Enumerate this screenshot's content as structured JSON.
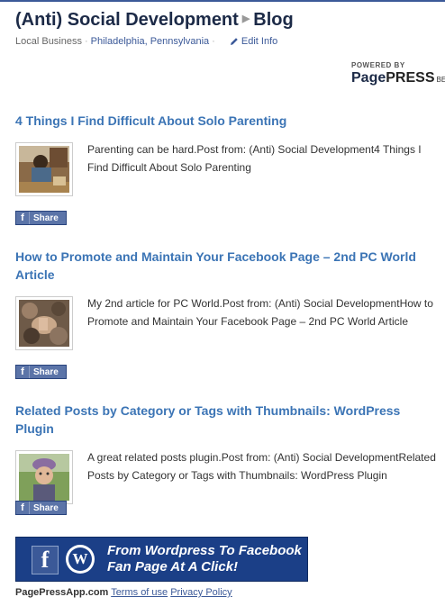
{
  "header": {
    "page_name": "(Anti) Social Development",
    "section": "Blog",
    "category": "Local Business",
    "location": "Philadelphia, Pennsylvania",
    "edit_label": "Edit Info"
  },
  "powered": {
    "small": "POWERED BY",
    "brand_a": "Page",
    "brand_b": "PRESS",
    "beta": "BETA"
  },
  "posts": [
    {
      "title": "4 Things I Find Difficult About Solo Parenting",
      "excerpt": "Parenting can be hard.Post from: (Anti) Social Development4 Things I Find Difficult About Solo Parenting",
      "share": "Share"
    },
    {
      "title": "How to Promote and Maintain Your Facebook Page – 2nd PC World Article",
      "excerpt": "My 2nd article for PC World.Post from: (Anti) Social DevelopmentHow to Promote and Maintain Your Facebook Page – 2nd PC World Article",
      "share": "Share"
    },
    {
      "title": "Related Posts by Category or Tags with Thumbnails: WordPress Plugin",
      "excerpt": "A great related posts plugin.Post from: (Anti) Social DevelopmentRelated Posts by Category or Tags with Thumbnails: WordPress Plugin",
      "share": "Share"
    }
  ],
  "share_icon": "f",
  "banner": {
    "fb_letter": "f",
    "wp_letter": "W",
    "line1": "From Wordpress To Facebook",
    "line2": "Fan Page At A Click!"
  },
  "footer": {
    "site": "PagePressApp.com",
    "terms": "Terms of use",
    "privacy": "Privacy Policy"
  }
}
